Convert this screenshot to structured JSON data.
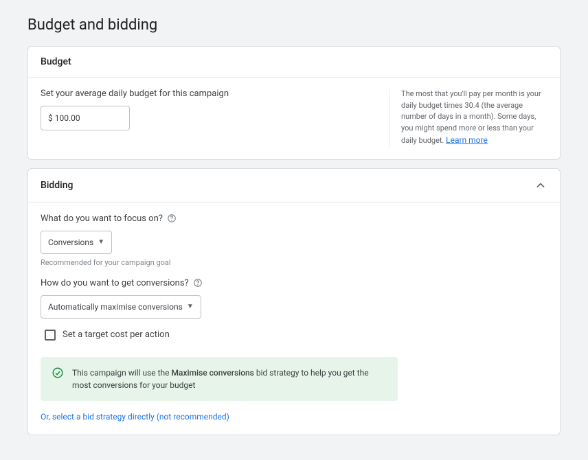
{
  "page_title": "Budget and bidding",
  "budget": {
    "title": "Budget",
    "label": "Set your average daily budget for this campaign",
    "value": "$ 100.00",
    "note": "The most that you'll pay per month is your daily budget times 30.4 (the average number of days in a month). Some days, you might spend more or less than your daily budget. ",
    "learn_more": "Learn more"
  },
  "bidding": {
    "title": "Bidding",
    "focus_label": "What do you want to focus on?",
    "focus_value": "Conversions",
    "recommended": "Recommended for your campaign goal",
    "how_label": "How do you want to get conversions?",
    "how_value": "Automatically maximise conversions",
    "checkbox_label": "Set a target cost per action",
    "info_prefix": "This campaign will use the ",
    "info_bold": "Maximise conversions",
    "info_suffix": " bid strategy to help you get the most conversions for your budget",
    "alt_link": "Or, select a bid strategy directly (not recommended)"
  }
}
